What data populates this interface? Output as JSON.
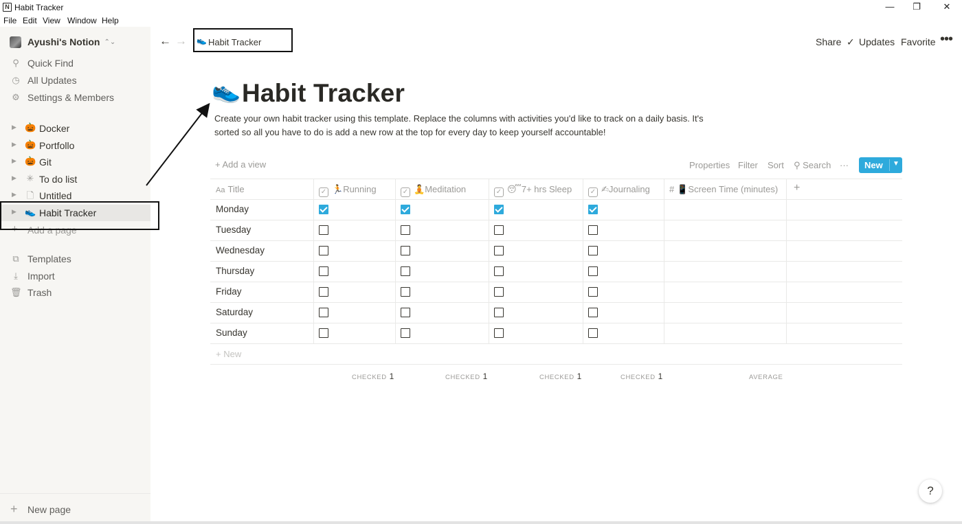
{
  "window": {
    "title": "Habit Tracker",
    "app_icon": "N",
    "minimize": "—",
    "maximize": "❐",
    "close": "✕"
  },
  "menu": [
    "File",
    "Edit",
    "View",
    "Window",
    "Help"
  ],
  "sidebar": {
    "workspace": "Ayushi's Notion",
    "quick": [
      {
        "icon": "search-icon",
        "glyph": "⚲",
        "label": "Quick Find"
      },
      {
        "icon": "clock-icon",
        "glyph": "◷",
        "label": "All Updates"
      },
      {
        "icon": "gear-icon",
        "glyph": "⚙",
        "label": "Settings & Members"
      }
    ],
    "pages": [
      {
        "icon": "pumpkin-icon",
        "glyph": "🎃",
        "label": "Docker"
      },
      {
        "icon": "pumpkin-icon",
        "glyph": "🎃",
        "label": "Portfollo"
      },
      {
        "icon": "pumpkin-icon",
        "glyph": "🎃",
        "label": "Git"
      },
      {
        "icon": "snowflake-icon",
        "glyph": "✳",
        "label": "To do list"
      },
      {
        "icon": "page-icon",
        "glyph": "🗋",
        "label": "Untitled"
      },
      {
        "icon": "shoe-icon",
        "glyph": "👟",
        "label": "Habit Tracker",
        "active": true
      }
    ],
    "add_page": "Add a page",
    "bottom": [
      {
        "icon": "templates-icon",
        "glyph": "⧉",
        "label": "Templates"
      },
      {
        "icon": "import-icon",
        "glyph": "⤓",
        "label": "Import"
      },
      {
        "icon": "trash-icon",
        "glyph": "🗑",
        "label": "Trash"
      }
    ],
    "new_page": "New page"
  },
  "topbar": {
    "breadcrumb": "Habit Tracker",
    "share": "Share",
    "updates": "Updates",
    "favorite": "Favorite",
    "more": "•••"
  },
  "page": {
    "icon": "👟",
    "title": "Habit Tracker",
    "description": "Create your own habit tracker using this template. Replace the columns with activities you'd like to track on a daily basis. It's sorted so all you have to do is add a new row at the top for every day to keep yourself accountable!"
  },
  "database": {
    "add_view": "Add a view",
    "properties": "Properties",
    "filter": "Filter",
    "sort": "Sort",
    "search": "Search",
    "more": "···",
    "new_label": "New",
    "columns": [
      {
        "key": "title",
        "label": "Title",
        "icon": "Aa"
      },
      {
        "key": "running",
        "label": "Running",
        "icon": "🏃"
      },
      {
        "key": "meditation",
        "label": "Meditation",
        "icon": "🧘"
      },
      {
        "key": "sleep",
        "label": "7+ hrs Sleep",
        "icon": "😴"
      },
      {
        "key": "journaling",
        "label": "Journaling",
        "icon": "✍"
      },
      {
        "key": "screen",
        "label": "Screen Time (minutes)",
        "icon": "📱"
      }
    ],
    "rows": [
      {
        "title": "Monday",
        "running": true,
        "meditation": true,
        "sleep": true,
        "journaling": true
      },
      {
        "title": "Tuesday",
        "running": false,
        "meditation": false,
        "sleep": false,
        "journaling": false
      },
      {
        "title": "Wednesday",
        "running": false,
        "meditation": false,
        "sleep": false,
        "journaling": false
      },
      {
        "title": "Thursday",
        "running": false,
        "meditation": false,
        "sleep": false,
        "journaling": false
      },
      {
        "title": "Friday",
        "running": false,
        "meditation": false,
        "sleep": false,
        "journaling": false
      },
      {
        "title": "Saturday",
        "running": false,
        "meditation": false,
        "sleep": false,
        "journaling": false
      },
      {
        "title": "Sunday",
        "running": false,
        "meditation": false,
        "sleep": false,
        "journaling": false
      }
    ],
    "add_row": "New",
    "calculations": [
      {
        "label": "CHECKED",
        "value": "1"
      },
      {
        "label": "CHECKED",
        "value": "1"
      },
      {
        "label": "CHECKED",
        "value": "1"
      },
      {
        "label": "CHECKED",
        "value": "1"
      },
      {
        "label": "AVERAGE",
        "value": ""
      }
    ]
  },
  "help": "?",
  "colors": {
    "accent": "#2eaadc",
    "sidebar_bg": "#f7f6f3",
    "text": "#37352f",
    "muted": "#9b9a97"
  }
}
